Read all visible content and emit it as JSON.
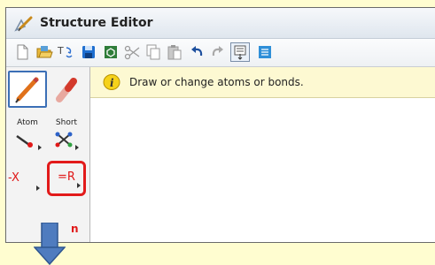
{
  "window": {
    "title": "Structure Editor"
  },
  "toolbar": {
    "buttons": [
      "new-document",
      "open-folder",
      "transform",
      "save",
      "clean-structure",
      "cut",
      "copy",
      "paste",
      "undo",
      "redo",
      "select-template",
      "list"
    ]
  },
  "tools": {
    "atom_label": "Atom",
    "short_label": "Short",
    "x_label": "-X",
    "r_label": "=R",
    "partial_label": "n"
  },
  "hint": {
    "text": "Draw or change atoms or bonds."
  },
  "colors": {
    "background": "#fffdd0",
    "accent_red": "#e21a1a",
    "selected_border": "#3b6fb6",
    "arrow": "#4f7cbf"
  }
}
